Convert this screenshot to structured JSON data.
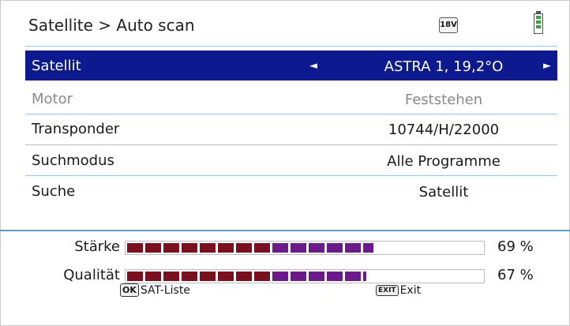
{
  "header": {
    "title": "Satellite > Auto scan",
    "voltage_badge": "18V",
    "battery_icon": "battery-icon"
  },
  "menu": [
    {
      "label": "Satellit",
      "value": "ASTRA 1, 19,2°O",
      "selected": true,
      "disabled": false
    },
    {
      "label": "Motor",
      "value": "Feststehen",
      "selected": false,
      "disabled": true
    },
    {
      "label": "Transponder",
      "value": "10744/H/22000",
      "selected": false,
      "disabled": false
    },
    {
      "label": "Suchmodus",
      "value": "Alle Programme",
      "selected": false,
      "disabled": false
    },
    {
      "label": "Suche",
      "value": "Satellit",
      "selected": false,
      "disabled": false
    }
  ],
  "arrows": {
    "left": "◄",
    "right": "►"
  },
  "meters": [
    {
      "label": "Stärke",
      "percent_text": "69 %",
      "level": 0.69
    },
    {
      "label": "Qualität",
      "percent_text": "67 %",
      "level": 0.67
    }
  ],
  "colors": {
    "selected_row": "#0d1a8f",
    "meter_red": "#7a0f1e",
    "meter_purple": "#6a1a8a",
    "separator": "#9ec3e6"
  },
  "footer": {
    "ok_key": "OK",
    "ok_label": "SAT-Liste",
    "exit_key": "EXIT",
    "exit_label": "Exit"
  }
}
